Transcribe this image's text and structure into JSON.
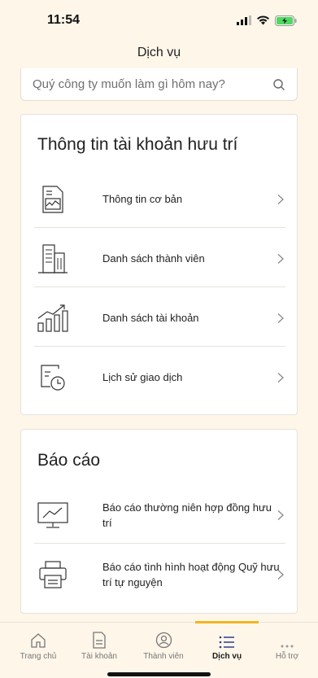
{
  "status_bar": {
    "time": "11:54"
  },
  "header": {
    "title": "Dịch vụ"
  },
  "search": {
    "placeholder": "Quý công ty muốn làm gì hôm nay?"
  },
  "account_section": {
    "title": "Thông tin tài khoản hưu trí",
    "items": [
      {
        "label": "Thông tin cơ bản",
        "icon": "document-chart-icon"
      },
      {
        "label": "Danh sách thành viên",
        "icon": "building-icon"
      },
      {
        "label": "Danh sách tài khoản",
        "icon": "growth-chart-icon"
      },
      {
        "label": "Lịch sử giao dịch",
        "icon": "history-clock-icon"
      }
    ]
  },
  "report_section": {
    "title": "Báo cáo",
    "items": [
      {
        "label": "Báo cáo thường niên hợp đồng hưu trí",
        "icon": "monitor-chart-icon"
      },
      {
        "label": "Báo cáo tình hình hoạt động Quỹ hưu trí tự nguyện",
        "icon": "printer-icon"
      }
    ]
  },
  "tab_bar": {
    "tabs": [
      {
        "label": "Trang chủ",
        "icon": "home-icon"
      },
      {
        "label": "Tài khoản",
        "icon": "document-icon"
      },
      {
        "label": "Thành viên",
        "icon": "member-icon"
      },
      {
        "label": "Dịch vụ",
        "icon": "list-icon",
        "active": true
      },
      {
        "label": "Hỗ trợ",
        "icon": "more-dots-icon"
      }
    ]
  },
  "colors": {
    "accent": "#f3b520",
    "background": "#fdf6e9",
    "battery": "#4cd964"
  }
}
